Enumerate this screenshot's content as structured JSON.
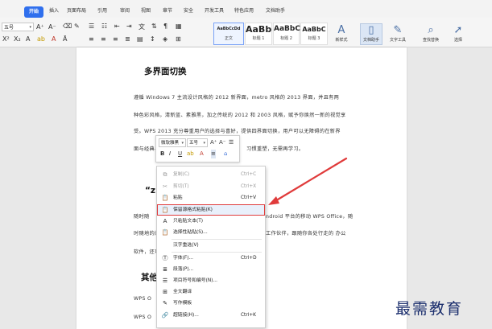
{
  "toolbar": {
    "tabs": [
      {
        "label": "开始",
        "active": true
      },
      {
        "label": "插入"
      },
      {
        "label": "页面布局"
      },
      {
        "label": "引用"
      },
      {
        "label": "审阅"
      },
      {
        "label": "视图"
      },
      {
        "label": "章节"
      },
      {
        "label": "安全"
      },
      {
        "label": "开发工具"
      },
      {
        "label": "特色应用"
      },
      {
        "label": "文档助手"
      }
    ],
    "font_name": "五号",
    "font_size_increase": "A⁺",
    "font_size_decrease": "A⁻",
    "styles": [
      {
        "preview": "AaBbCcDd",
        "label": "正文",
        "selected": true
      },
      {
        "preview": "AaBb",
        "label": "标题 1"
      },
      {
        "preview": "AaBbC",
        "label": "标题 2"
      },
      {
        "preview": "AaBbC",
        "label": "标题 3"
      }
    ],
    "new_style_label": "新样式",
    "doc_helper_label": "文档助手",
    "text_tools_label": "文字工具",
    "find_replace_label": "查找替换",
    "select_label": "选择"
  },
  "document": {
    "heading1": "多界面切换",
    "para1": [
      "遵循 Windows 7 主流设计风格的 2012 新界面，metro 风格的 2013 界面，并且有两",
      "种色彩风格，清新蓝、素雅黑，加之传统的 2012 和 2003 风格，赋予你焕然一新的视觉享",
      "受。WPS 2013 充分尊重用户的选择与喜好，提供四界面切换，用户可以无障碍的在新界",
      "面与经典界"
    ],
    "para1_tail": "习惯重塑，无需再学习。",
    "heading2_fragment": "“z",
    "para2": [
      {
        "left": "随时随",
        "right": "ndroid 平台的移动 WPS Office，随"
      },
      {
        "left": "时随地的阅",
        "right": "工作伙伴，跟随你各处行走的 办公"
      },
      {
        "left": "软件，还可",
        "right": ""
      }
    ],
    "heading3_fragment": "其他",
    "para3": [
      "WPS O",
      "WPS O"
    ]
  },
  "mini_toolbar": {
    "font": "微软雅黑",
    "size": "五号",
    "grow": "A⁺",
    "shrink": "A⁻",
    "list": "☰",
    "bold": "B",
    "italic": "I",
    "underline": "U",
    "highlight": "ab",
    "font_color": "A",
    "align": "≡",
    "paint": "⌂"
  },
  "context_menu": {
    "items": [
      {
        "label": "复制(C)",
        "shortcut": "Ctrl+C",
        "icon": "copy-icon",
        "glyph": "⧉",
        "disabled": true
      },
      {
        "label": "剪切(T)",
        "shortcut": "Ctrl+X",
        "icon": "scissors-icon",
        "glyph": "✂",
        "disabled": true
      },
      {
        "label": "粘贴",
        "shortcut": "Ctrl+V",
        "icon": "paste-icon",
        "glyph": "📋"
      },
      {
        "label": "保留源格式粘贴(K)",
        "shortcut": "",
        "icon": "paste-keep-format-icon",
        "glyph": "📋",
        "highlight": true
      },
      {
        "label": "只粘贴文本(T)",
        "shortcut": "",
        "icon": "paste-text-icon",
        "glyph": "A"
      },
      {
        "label": "选择性粘贴(S)...",
        "shortcut": "",
        "icon": "paste-special-icon",
        "glyph": "📋"
      },
      {
        "label": "汉字重选(V)",
        "shortcut": "",
        "icon": "",
        "glyph": ""
      },
      {
        "label": "字体(F)...",
        "shortcut": "Ctrl+D",
        "icon": "font-icon",
        "glyph": "Ⓣ"
      },
      {
        "label": "段落(P)...",
        "shortcut": "",
        "icon": "paragraph-icon",
        "glyph": "≣"
      },
      {
        "label": "项目符号和编号(N)...",
        "shortcut": "",
        "icon": "bullets-icon",
        "glyph": "☰"
      },
      {
        "label": "全文翻译",
        "shortcut": "",
        "icon": "translate-icon",
        "glyph": "⊞"
      },
      {
        "label": "写作模板",
        "shortcut": "",
        "icon": "template-icon",
        "glyph": "✎"
      },
      {
        "label": "超链接(H)...",
        "shortcut": "Ctrl+K",
        "icon": "hyperlink-icon",
        "glyph": "🔗"
      }
    ]
  },
  "watermark": "最需教育",
  "colors": {
    "accent": "#2f6fed",
    "highlight_border": "#e03b3b",
    "arrow": "#e03b3b",
    "watermark": "#1c2f6e"
  }
}
